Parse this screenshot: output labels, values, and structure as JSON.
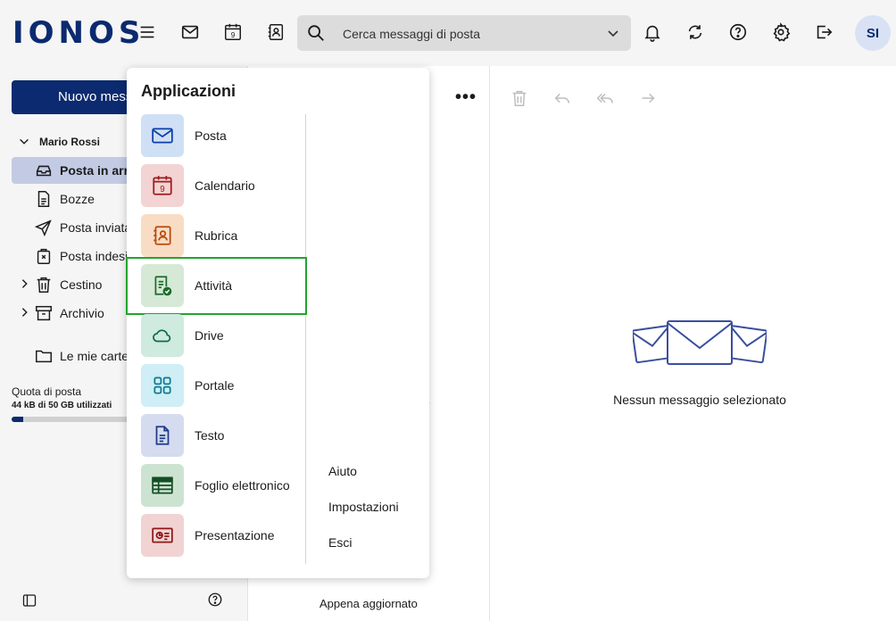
{
  "header": {
    "logo": "IONOS",
    "search_placeholder": "Cerca messaggi di posta",
    "calendar_day": "9",
    "avatar_initials": "SI"
  },
  "sidebar": {
    "new_button": "Nuovo messaggio",
    "account_name": "Mario Rossi",
    "folders": [
      {
        "label": "Posta in arrivo",
        "icon": "inbox-icon"
      },
      {
        "label": "Bozze",
        "icon": "draft-icon"
      },
      {
        "label": "Posta inviata",
        "icon": "send-icon"
      },
      {
        "label": "Posta indesiderata",
        "icon": "spam-icon"
      },
      {
        "label": "Cestino",
        "icon": "trash-icon"
      },
      {
        "label": "Archivio",
        "icon": "archive-icon"
      },
      {
        "label": "Le mie cartelle",
        "icon": "folder-icon"
      }
    ],
    "quota_title": "Quota di posta",
    "quota_value": "44 kB di 50 GB utilizzati",
    "quota_fraction": 0.09
  },
  "list": {
    "more_label": "•••",
    "partial_text": "a",
    "footer": "Appena aggiornato"
  },
  "reading": {
    "empty_text": "Nessun messaggio selezionato"
  },
  "apps_menu": {
    "title": "Applicazioni",
    "items": [
      {
        "label": "Posta",
        "tile_color": "#cfe0f5",
        "icon_color": "#0b3ea8"
      },
      {
        "label": "Calendario",
        "tile_color": "#f3d3d3",
        "icon_color": "#a11a1a"
      },
      {
        "label": "Rubrica",
        "tile_color": "#f9dcc4",
        "icon_color": "#b84a0a"
      },
      {
        "label": "Attività",
        "tile_color": "#d5e9d6",
        "icon_color": "#1c6b2a"
      },
      {
        "label": "Drive",
        "tile_color": "#cfeadf",
        "icon_color": "#0d6a4f"
      },
      {
        "label": "Portale",
        "tile_color": "#cfeef5",
        "icon_color": "#0d7a93"
      },
      {
        "label": "Testo",
        "tile_color": "#d5dcf0",
        "icon_color": "#1d3a8a"
      },
      {
        "label": "Foglio elettronico",
        "tile_color": "#cde3d2",
        "icon_color": "#134f23"
      },
      {
        "label": "Presentazione",
        "tile_color": "#f1d3d3",
        "icon_color": "#8e1818"
      }
    ],
    "side_links": [
      "Aiuto",
      "Impostazioni",
      "Esci"
    ]
  }
}
